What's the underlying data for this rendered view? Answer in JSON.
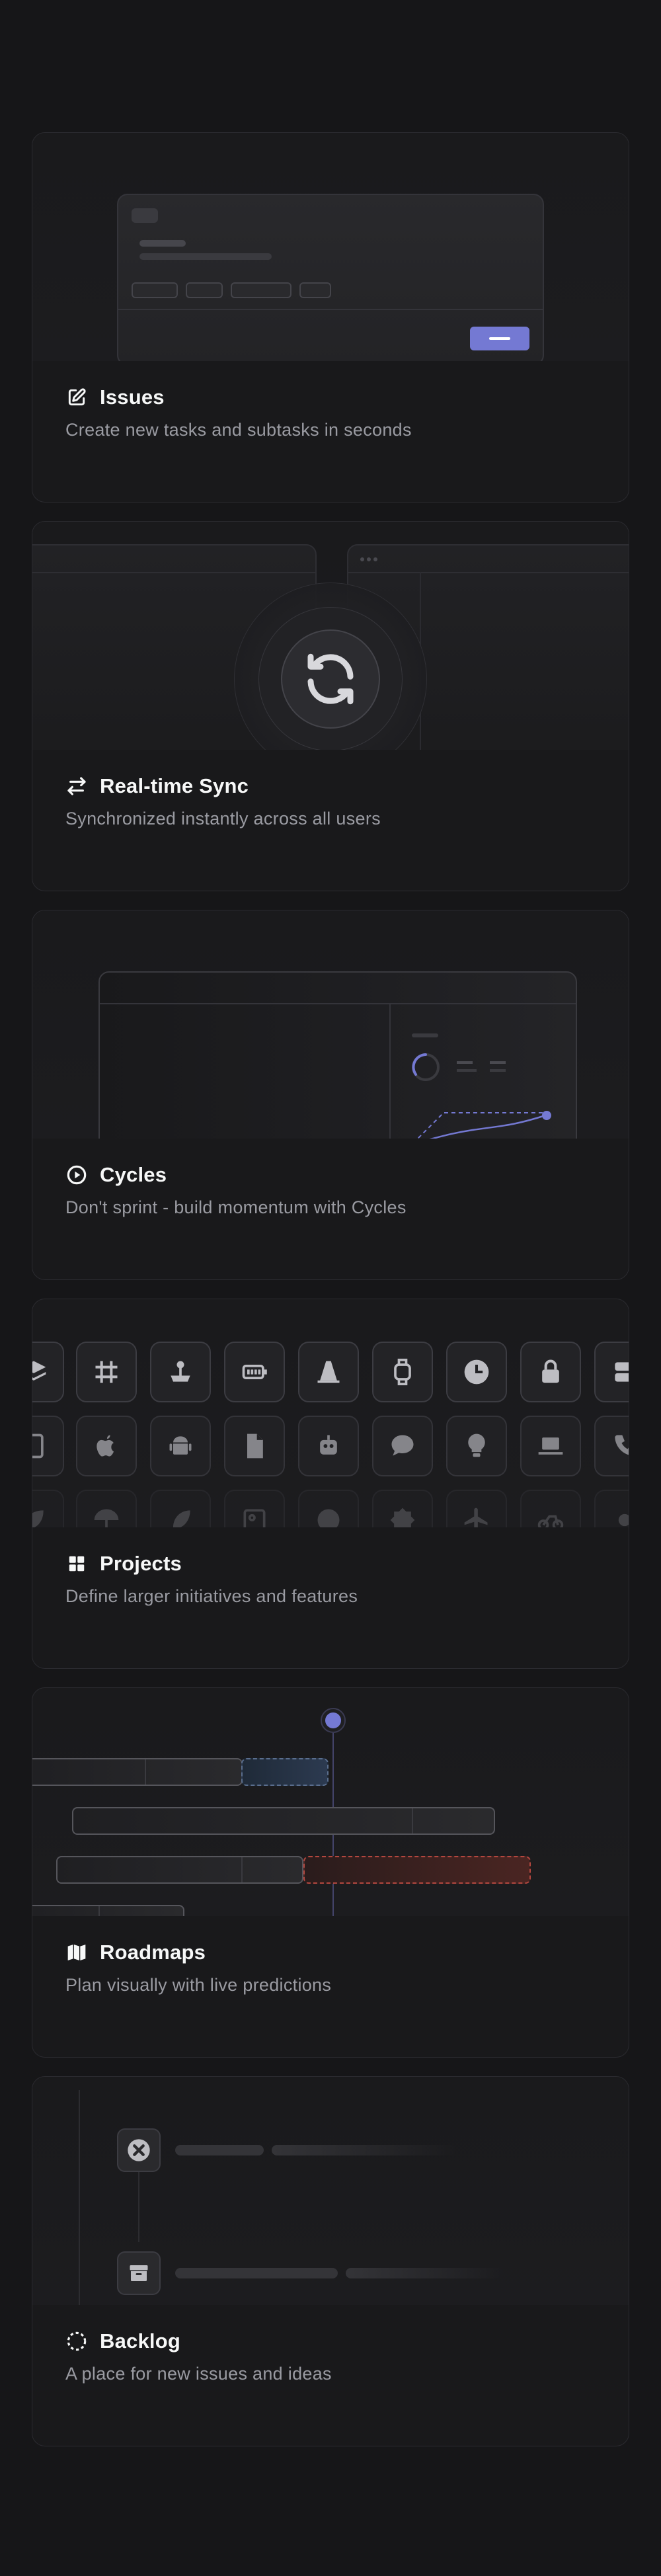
{
  "cards": [
    {
      "title": "Issues",
      "description": "Create new tasks and subtasks in seconds",
      "icon": "pencil-square-icon"
    },
    {
      "title": "Real-time Sync",
      "description": "Synchronized instantly across all users",
      "icon": "sync-arrows-icon"
    },
    {
      "title": "Cycles",
      "description": "Don't sprint - build momentum with Cycles",
      "icon": "play-circle-icon"
    },
    {
      "title": "Projects",
      "description": "Define larger initiatives and features",
      "icon": "grid-icon"
    },
    {
      "title": "Roadmaps",
      "description": "Plan visually with live predictions",
      "icon": "map-icon"
    },
    {
      "title": "Backlog",
      "description": "A place for new issues and ideas",
      "icon": "dashed-circle-icon"
    }
  ],
  "colors": {
    "accent": "#7479d3",
    "background": "#161618",
    "card": "#19191b",
    "text_primary": "#f7f8f8",
    "text_secondary": "#9a9ba2",
    "danger": "#c0453c"
  },
  "project_icons_row1": [
    "stack-icon",
    "grid-hash-icon",
    "joystick-icon",
    "battery-icon",
    "cone-icon",
    "watch-icon",
    "clock-icon",
    "lock-icon",
    "server-icon"
  ],
  "project_icons_row2": [
    "device-icon",
    "apple-icon",
    "android-icon",
    "document-icon",
    "robot-icon",
    "chat-icon",
    "lightbulb-icon",
    "laptop-icon",
    "phone-icon"
  ],
  "project_icons_row3": [
    "leaf-icon",
    "umbrella-icon",
    "feather-icon",
    "image-icon",
    "face-icon",
    "badge-icon",
    "plane-icon",
    "bike-icon",
    "sun-icon"
  ]
}
